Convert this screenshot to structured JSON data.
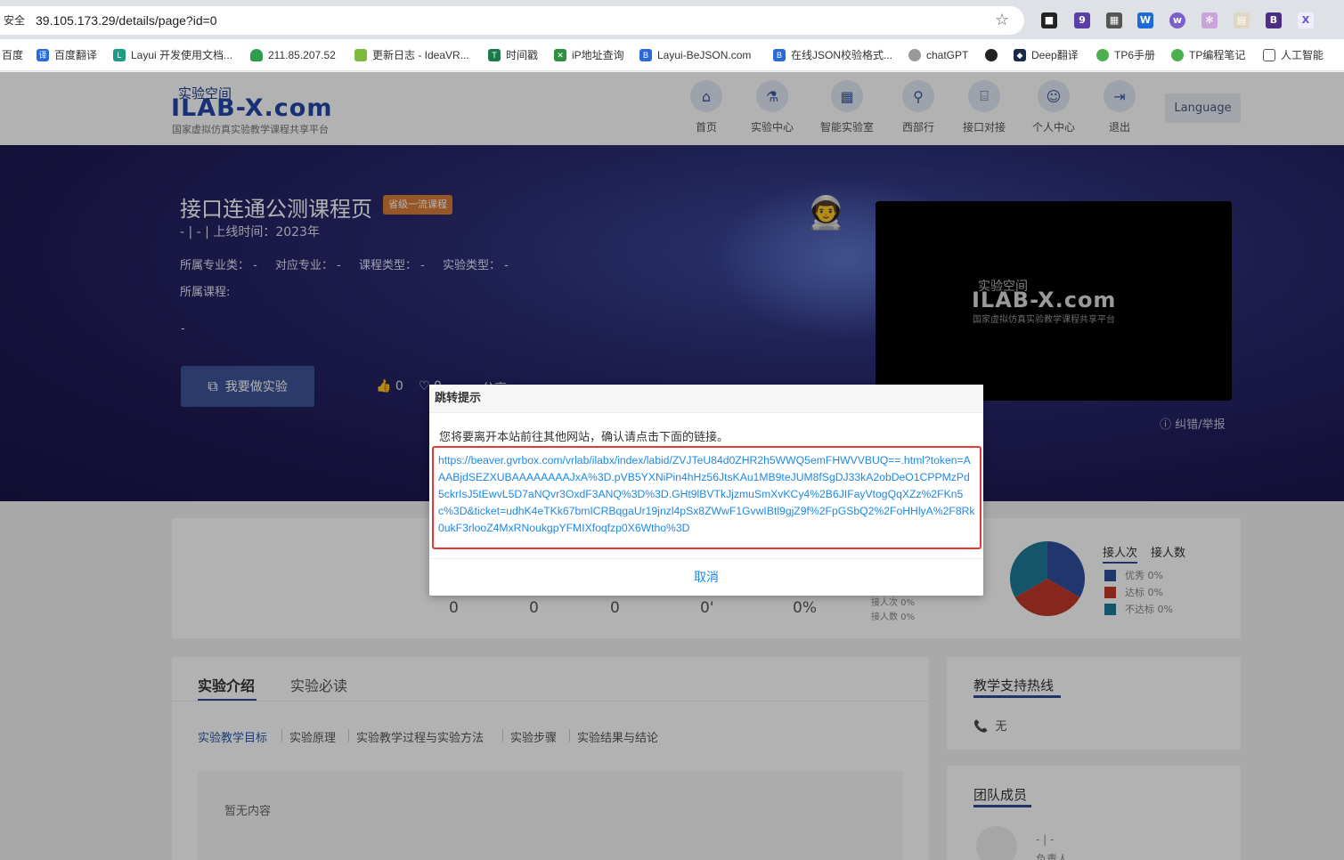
{
  "browser": {
    "security_label": "安全",
    "url": "39.105.173.29/details/page?id=0",
    "ext_badge": "9",
    "bookmarks": [
      "百度",
      "百度翻译",
      "Layui 开发使用文档...",
      "211.85.207.52",
      "更新日志 - IdeaVR...",
      "时间戳",
      "iP地址查询",
      "Layui-BeJSON.com",
      "在线JSON校验格式...",
      "chatGPT",
      "Deep翻译",
      "TP6手册",
      "TP编程笔记",
      "人工智能"
    ]
  },
  "site": {
    "logo_cn": "实验空间",
    "logo_en": "ILAB-X.com",
    "logo_sub": "国家虚拟仿真实验教学课程共享平台",
    "nav": [
      "首页",
      "实验中心",
      "智能实验室",
      "西部行",
      "接口对接",
      "个人中心",
      "退出"
    ],
    "language": "Language"
  },
  "course": {
    "title": "接口连通公测课程页",
    "level_badge": "省级一流课程",
    "meta": "- | - | 上线时间：2023年",
    "fields": [
      "所属专业类： -",
      "对应专业： -",
      "课程类型： -",
      "实验类型： -"
    ],
    "owner_course": "所属课程:",
    "desc": "-",
    "do_button": "我要做实验",
    "likes": "0",
    "favs": "0",
    "share": "分享",
    "report": "纠错/举报"
  },
  "video": {
    "logo_cn": "实验空间",
    "logo_en": "ILAB-X.com",
    "logo_sub": "国家虚拟仿真实验教学课程共享平台"
  },
  "stats": {
    "values": [
      "0",
      "0",
      "0",
      "0'",
      "0%"
    ],
    "tiny1": "接人次 0%",
    "tiny2": "接人数 0%",
    "tab_times": "接人次",
    "tab_people": "接人数",
    "legend": [
      {
        "label": "优秀 0%",
        "color": "#2f4e9b"
      },
      {
        "label": "达标 0%",
        "color": "#c0392b"
      },
      {
        "label": "不达标 0%",
        "color": "#1f7a99"
      }
    ]
  },
  "intro": {
    "tabs": [
      "实验介绍",
      "实验必读"
    ],
    "subtabs": [
      "实验教学目标",
      "实验原理",
      "实验教学过程与实验方法",
      "实验步骤",
      "实验结果与结论"
    ],
    "empty": "暂无内容"
  },
  "hotline": {
    "title": "教学支持热线",
    "value": "无"
  },
  "team": {
    "title": "团队成员",
    "meta": "- | -",
    "role": "负责人"
  },
  "dialog": {
    "title": "跳转提示",
    "message": "您将要离开本站前往其他网站，确认请点击下面的链接。",
    "link": "https://beaver.gvrbox.com/vrlab/ilabx/index/labid/ZVJTeU84d0ZHR2h5WWQ5emFHWVVBUQ==.html?token=AAABjdSEZXUBAAAAAAAAJxA%3D.pVB5YXNiPin4hHz56JtsKAu1MB9teJUM8fSgDJ33kA2obDeO1CPPMzPd5ckrIsJ5tEwvL5D7aNQvr3OxdF3ANQ%3D%3D.GHt9lBVTkJjzmuSmXvKCy4%2B6JIFayVtogQqXZz%2FKn5c%3D&ticket=udhK4eTKk67bmICRBqgaUr19jnzl4pSx8ZWwF1GvwIBtl9gjZ9f%2FpGSbQ2%2FoHHlyA%2F8Rk0ukF3rlooZ4MxRNoukgpYFMIXfoqfzp0X6Wtho%3D",
    "cancel": "取消"
  }
}
